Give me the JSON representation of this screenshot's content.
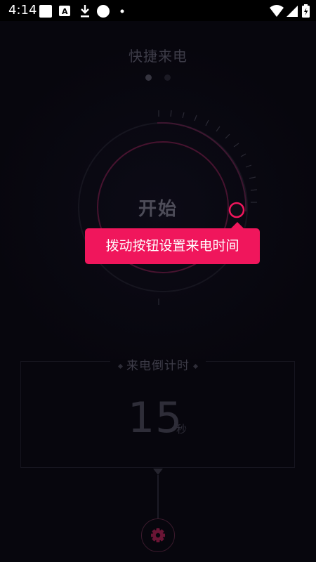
{
  "status_bar": {
    "time": "4:14",
    "left_icons": [
      "square-notification-icon",
      "font-app-icon",
      "download-icon",
      "circle-icon",
      "dot-icon"
    ],
    "right_icons": [
      "wifi-icon",
      "signal-icon",
      "battery-charging-icon"
    ]
  },
  "header": {
    "title": "快捷来电",
    "page_indicator": {
      "count": 2,
      "active": 0
    }
  },
  "dial": {
    "center_label": "开始",
    "accent_color": "#f0165c"
  },
  "tooltip": {
    "text": "拨动按钮设置来电时间"
  },
  "countdown": {
    "label": "来电倒计时",
    "value": "15",
    "unit": "秒"
  },
  "settings": {
    "icon": "gear-icon"
  }
}
